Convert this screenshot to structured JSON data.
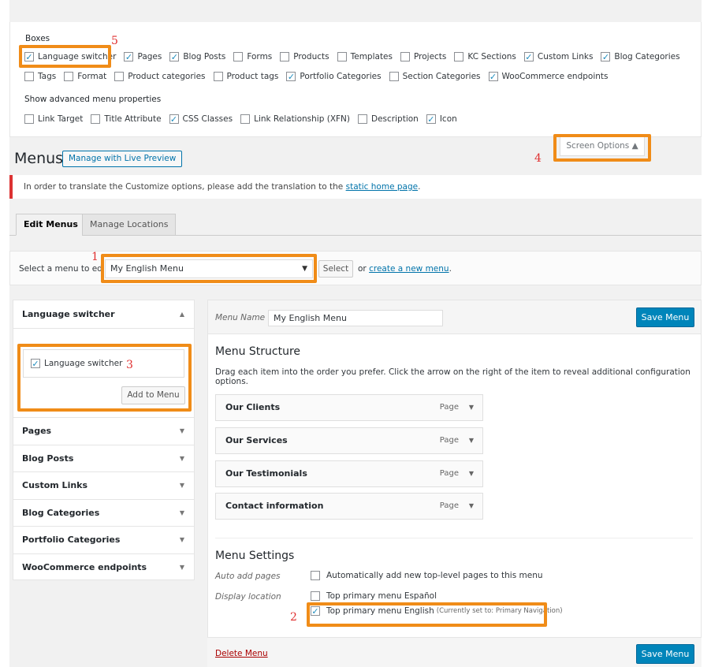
{
  "screen_options": {
    "boxes_title": "Boxes",
    "boxes_row1": [
      {
        "label": "Language switcher",
        "checked": true
      },
      {
        "label": "Pages",
        "checked": true
      },
      {
        "label": "Blog Posts",
        "checked": true
      },
      {
        "label": "Forms",
        "checked": false
      },
      {
        "label": "Products",
        "checked": false
      },
      {
        "label": "Templates",
        "checked": false
      },
      {
        "label": "Projects",
        "checked": false
      },
      {
        "label": "KC Sections",
        "checked": false
      },
      {
        "label": "Custom Links",
        "checked": true
      },
      {
        "label": "Blog Categories",
        "checked": true
      }
    ],
    "boxes_row2": [
      {
        "label": "Tags",
        "checked": false
      },
      {
        "label": "Format",
        "checked": false
      },
      {
        "label": "Product categories",
        "checked": false
      },
      {
        "label": "Product tags",
        "checked": false
      },
      {
        "label": "Portfolio Categories",
        "checked": true
      },
      {
        "label": "Section Categories",
        "checked": false
      },
      {
        "label": "WooCommerce endpoints",
        "checked": true
      }
    ],
    "advanced_title": "Show advanced menu properties",
    "advanced_row": [
      {
        "label": "Link Target",
        "checked": false
      },
      {
        "label": "Title Attribute",
        "checked": false
      },
      {
        "label": "CSS Classes",
        "checked": true
      },
      {
        "label": "Link Relationship (XFN)",
        "checked": false
      },
      {
        "label": "Description",
        "checked": false
      },
      {
        "label": "Icon",
        "checked": true
      }
    ],
    "toggle_label": "Screen Options ▲"
  },
  "header": {
    "title": "Menus",
    "live_preview": "Manage with Live Preview"
  },
  "notice": {
    "text": "In order to translate the Customize options, please add the translation to the",
    "link": "static home page",
    "end": "."
  },
  "tabs": {
    "edit": "Edit Menus",
    "manage": "Manage Locations"
  },
  "select_menu": {
    "label": "Select a menu to edit:",
    "value": "My English Menu",
    "select_btn": "Select",
    "or": "or",
    "create_link": "create a new menu",
    "period": "."
  },
  "left_panel": {
    "open_section": "Language switcher",
    "checkbox_label": "Language switcher",
    "add_btn": "Add to Menu",
    "sections": [
      "Pages",
      "Blog Posts",
      "Custom Links",
      "Blog Categories",
      "Portfolio Categories",
      "WooCommerce endpoints"
    ],
    "arrow_up": "▲",
    "arrow_down": "▼"
  },
  "right_panel": {
    "menu_name_label": "Menu Name",
    "menu_name_value": "My English Menu",
    "save_label": "Save Menu",
    "structure_title": "Menu Structure",
    "structure_desc": "Drag each item into the order you prefer. Click the arrow on the right of the item to reveal additional configuration options.",
    "items": [
      {
        "title": "Our Clients",
        "type": "Page"
      },
      {
        "title": "Our Services",
        "type": "Page"
      },
      {
        "title": "Our Testimonials",
        "type": "Page"
      },
      {
        "title": "Contact information",
        "type": "Page"
      }
    ],
    "settings_title": "Menu Settings",
    "auto_add_label": "Auto add pages",
    "auto_add_text": "Automatically add new top-level pages to this menu",
    "display_label": "Display location",
    "loc_es": "Top primary menu Español",
    "loc_en": "Top primary menu English",
    "loc_en_note": "(Currently set to: Primary Navigation)",
    "delete_label": "Delete Menu"
  },
  "annotations": {
    "n1": "1",
    "n2": "2",
    "n3": "3",
    "n4": "4",
    "n5": "5",
    "color": "#f08c18",
    "number_color": "#e03030"
  }
}
